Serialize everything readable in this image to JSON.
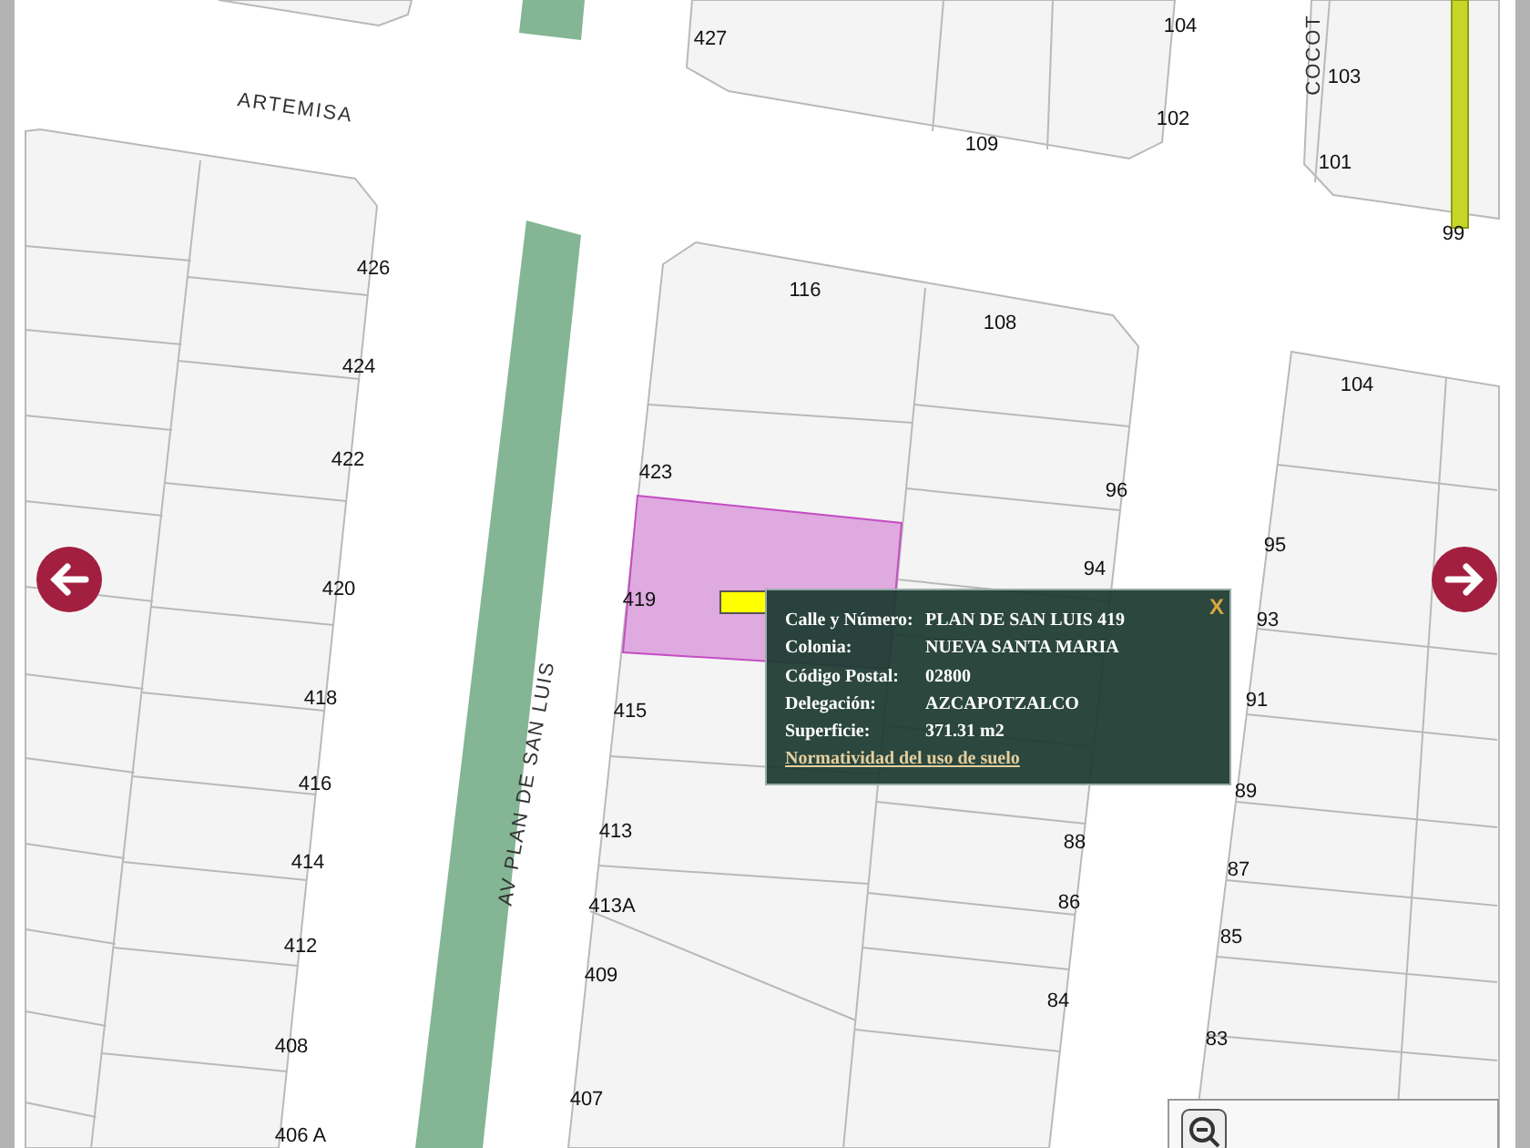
{
  "streets": [
    {
      "name": "ARTEMISA"
    },
    {
      "name": "AV PLAN DE SAN LUIS"
    },
    {
      "name": "COCOT"
    }
  ],
  "lot_numbers": [
    "427",
    "104",
    "103",
    "109",
    "102",
    "101",
    "99",
    "426",
    "116",
    "108",
    "424",
    "104",
    "422",
    "423",
    "96",
    "95",
    "94",
    "420",
    "419",
    "93",
    "418",
    "415",
    "91",
    "416",
    "89",
    "413",
    "88",
    "414",
    "87",
    "413A",
    "86",
    "412",
    "85",
    "409",
    "84",
    "408",
    "83",
    "407",
    "406 A"
  ],
  "info_popup": {
    "close": "X",
    "fields": [
      {
        "label": "Calle y Número:",
        "value": "PLAN DE SAN LUIS 419"
      },
      {
        "label": "Colonia:",
        "value": "NUEVA SANTA MARIA"
      },
      {
        "label": "Código Postal:",
        "value": "02800"
      },
      {
        "label": "Delegación:",
        "value": "AZCAPOTZALCO"
      },
      {
        "label": "Superficie:",
        "value": "371.31 m2"
      }
    ],
    "link": "Normatividad del uso de suelo"
  }
}
